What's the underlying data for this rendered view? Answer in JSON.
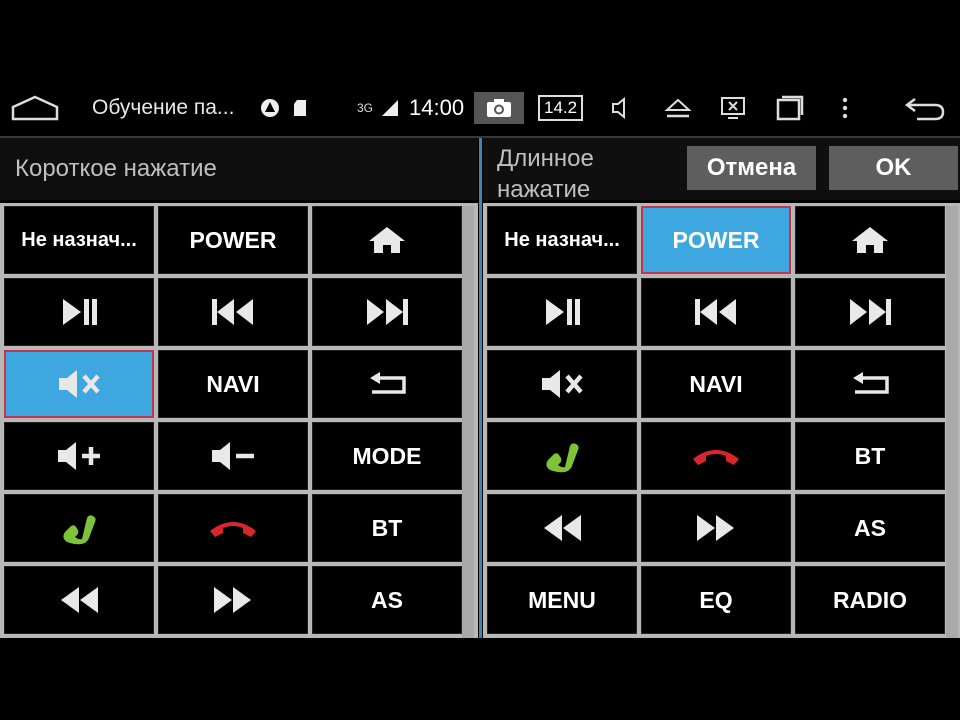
{
  "statusbar": {
    "app_title": "Обучение па...",
    "signal_text": "3G",
    "time": "14:00",
    "volume_value": "14.2"
  },
  "short_press": {
    "heading": "Короткое нажатие",
    "buttons": [
      {
        "label": "Не назнач...",
        "icon": ""
      },
      {
        "label": "POWER",
        "icon": ""
      },
      {
        "label": "",
        "icon": "home-icon"
      },
      {
        "label": "",
        "icon": "play-pause-icon"
      },
      {
        "label": "",
        "icon": "prev-track-icon"
      },
      {
        "label": "",
        "icon": "next-track-icon"
      },
      {
        "label": "",
        "icon": "mute-icon",
        "selected": true
      },
      {
        "label": "NAVI",
        "icon": ""
      },
      {
        "label": "",
        "icon": "back-icon"
      },
      {
        "label": "",
        "icon": "volume-up-icon"
      },
      {
        "label": "",
        "icon": "volume-down-icon"
      },
      {
        "label": "MODE",
        "icon": ""
      },
      {
        "label": "",
        "icon": "call-answer-icon"
      },
      {
        "label": "",
        "icon": "call-end-icon"
      },
      {
        "label": "BT",
        "icon": ""
      },
      {
        "label": "",
        "icon": "rewind-icon"
      },
      {
        "label": "",
        "icon": "fast-forward-icon"
      },
      {
        "label": "AS",
        "icon": ""
      }
    ]
  },
  "long_press": {
    "heading": "Длинное нажатие",
    "cancel_label": "Отмена",
    "ok_label": "OK",
    "buttons": [
      {
        "label": "Не назнач...",
        "icon": ""
      },
      {
        "label": "POWER",
        "icon": "",
        "selected": true
      },
      {
        "label": "",
        "icon": "home-icon"
      },
      {
        "label": "",
        "icon": "play-pause-icon"
      },
      {
        "label": "",
        "icon": "prev-track-icon"
      },
      {
        "label": "",
        "icon": "next-track-icon"
      },
      {
        "label": "",
        "icon": "mute-icon"
      },
      {
        "label": "NAVI",
        "icon": ""
      },
      {
        "label": "",
        "icon": "back-icon"
      },
      {
        "label": "",
        "icon": "call-answer-icon"
      },
      {
        "label": "",
        "icon": "call-end-icon"
      },
      {
        "label": "BT",
        "icon": ""
      },
      {
        "label": "",
        "icon": "rewind-icon"
      },
      {
        "label": "",
        "icon": "fast-forward-icon"
      },
      {
        "label": "AS",
        "icon": ""
      },
      {
        "label": "MENU",
        "icon": ""
      },
      {
        "label": "EQ",
        "icon": ""
      },
      {
        "label": "RADIO",
        "icon": ""
      }
    ]
  },
  "colors": {
    "accent": "#3fa7df",
    "selection_border": "#c0364a",
    "call_green": "#7ec23a",
    "call_red": "#d8262c"
  }
}
